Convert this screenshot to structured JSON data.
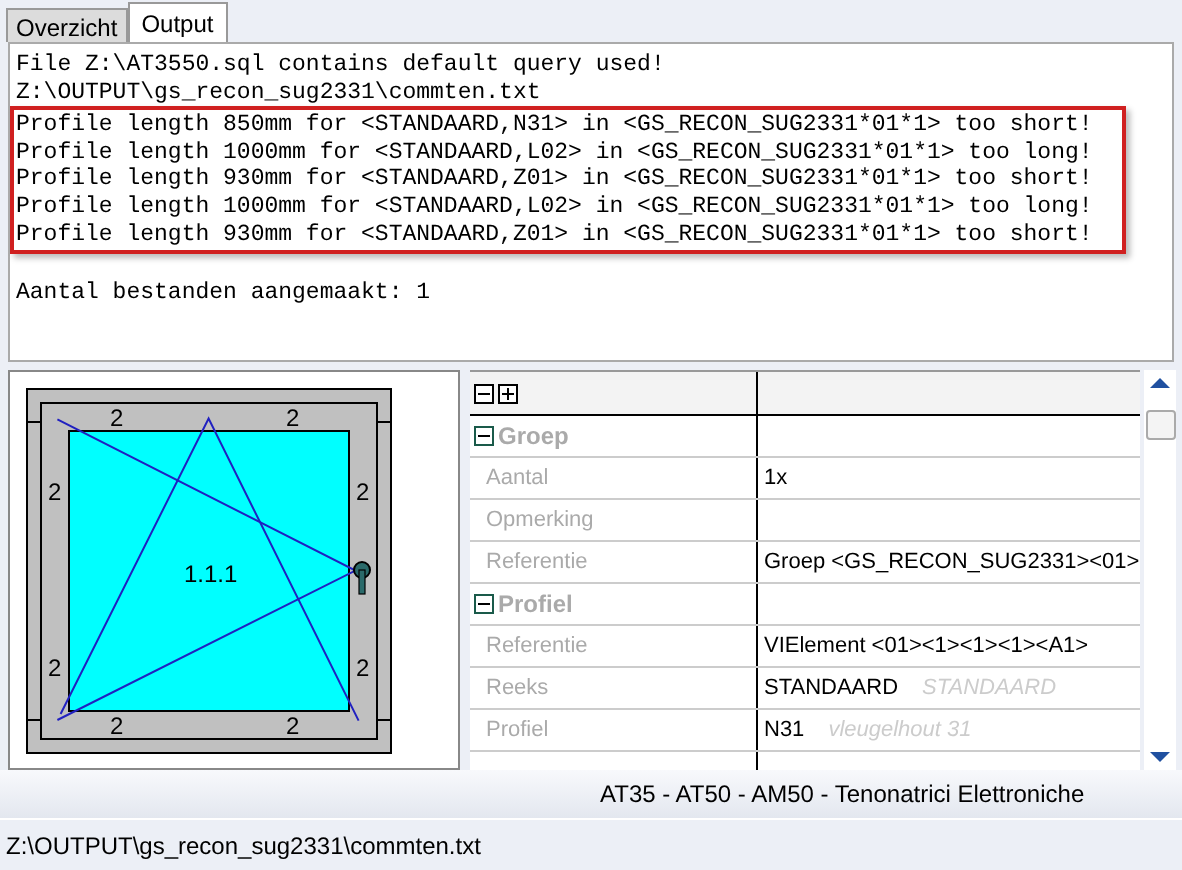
{
  "tabs": [
    {
      "label": "Overzicht",
      "selected": false
    },
    {
      "label": "Output",
      "selected": true
    }
  ],
  "output": {
    "lines_before": [
      "File Z:\\AT3550.sql contains default query used!",
      "Z:\\OUTPUT\\gs_recon_sug2331\\commten.txt"
    ],
    "highlighted_lines": [
      "Profile length 850mm for <STANDAARD,N31> in <GS_RECON_SUG2331*01*1> too short!",
      "Profile length 1000mm for <STANDAARD,L02> in <GS_RECON_SUG2331*01*1> too long!",
      "Profile length 930mm for <STANDAARD,Z01> in <GS_RECON_SUG2331*01*1> too short!",
      "Profile length 1000mm for <STANDAARD,L02> in <GS_RECON_SUG2331*01*1> too long!",
      "Profile length 930mm for <STANDAARD,Z01> in <GS_RECON_SUG2331*01*1> too short!"
    ],
    "lines_after": [
      "Aantal bestanden aangemaakt: 1"
    ]
  },
  "window_drawing": {
    "frame_labels": [
      "2",
      "2",
      "2",
      "2",
      "2",
      "2",
      "2",
      "2"
    ],
    "sash_label": "1.1.1"
  },
  "properties": {
    "rows": [
      {
        "kind": "group",
        "label": "Groep",
        "expanded": true
      },
      {
        "kind": "property",
        "label": "Aantal",
        "value": "1x"
      },
      {
        "kind": "property",
        "label": "Opmerking"
      },
      {
        "kind": "property",
        "label": "Referentie",
        "value": "Groep <GS_RECON_SUG2331><01>"
      },
      {
        "kind": "group",
        "label": "Profiel",
        "expanded": true
      },
      {
        "kind": "property",
        "label": "Referentie",
        "value": "VIElement <01><1><1><1><A1>"
      },
      {
        "kind": "property",
        "label": "Reeks",
        "value": "STANDAARD",
        "note": "STANDAARD"
      },
      {
        "kind": "property",
        "label": "Profiel",
        "value": "N31",
        "note": "vleugelhout 31"
      }
    ]
  },
  "app_title": "AT35 - AT50 - AM50 - Tenonatrici Elettroniche",
  "status_bar": "Z:\\OUTPUT\\gs_recon_sug2331\\commten.txt"
}
